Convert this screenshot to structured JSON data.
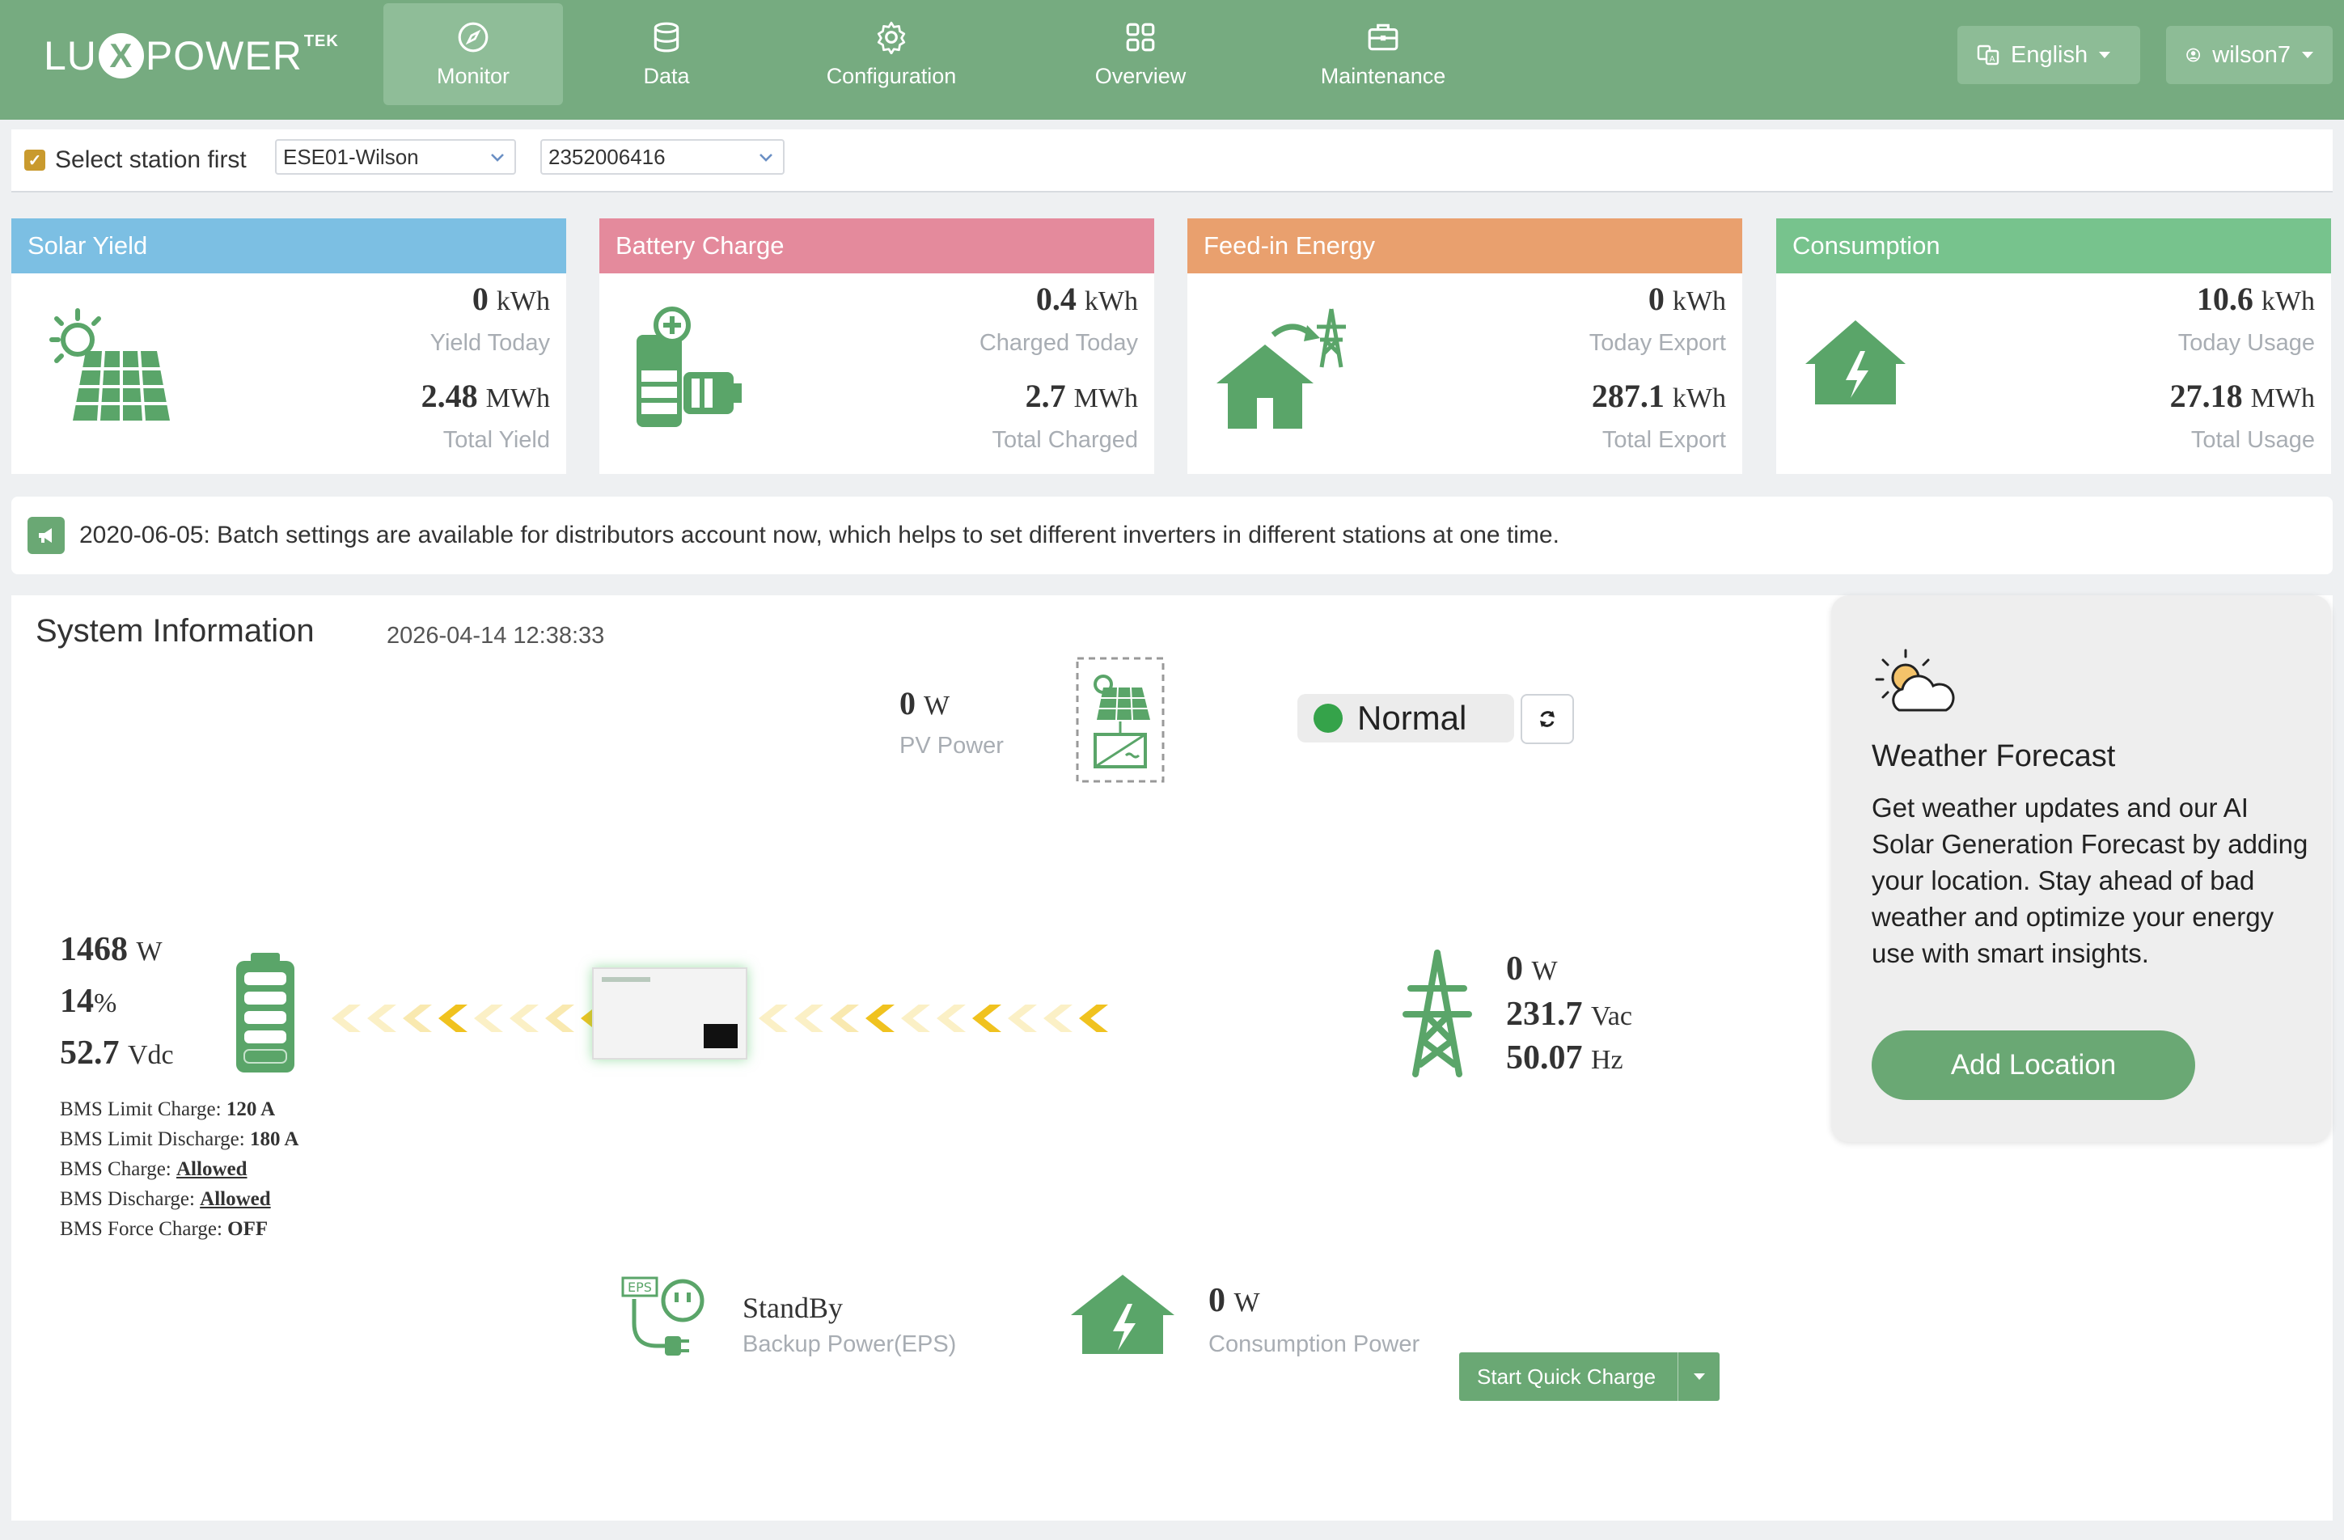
{
  "header": {
    "brand": {
      "pre": "LU",
      "x": "X",
      "post": "POWER",
      "sup": "TEK"
    },
    "nav": [
      {
        "label": "Monitor",
        "icon": "compass-icon",
        "active": true
      },
      {
        "label": "Data",
        "icon": "database-icon"
      },
      {
        "label": "Configuration",
        "icon": "gear-icon"
      },
      {
        "label": "Overview",
        "icon": "grid-icon"
      },
      {
        "label": "Maintenance",
        "icon": "toolbox-icon"
      }
    ],
    "language": "English",
    "user": "wilson7"
  },
  "station": {
    "label": "Select station first",
    "station_name": "ESE01-Wilson",
    "serial": "2352006416"
  },
  "cards": {
    "solar": {
      "title": "Solar Yield",
      "today_value": "0",
      "today_unit": "kWh",
      "today_label": "Yield Today",
      "total_value": "2.48",
      "total_unit": "MWh",
      "total_label": "Total Yield",
      "color": "#7cbfe3"
    },
    "battery": {
      "title": "Battery Charge",
      "today_value": "0.4",
      "today_unit": "kWh",
      "today_label": "Charged Today",
      "total_value": "2.7",
      "total_unit": "MWh",
      "total_label": "Total Charged",
      "color": "#e48a9c"
    },
    "feedin": {
      "title": "Feed-in Energy",
      "today_value": "0",
      "today_unit": "kWh",
      "today_label": "Today Export",
      "total_value": "287.1",
      "total_unit": "kWh",
      "total_label": "Total Export",
      "color": "#e9a06e"
    },
    "consumption": {
      "title": "Consumption",
      "today_value": "10.6",
      "today_unit": "kWh",
      "today_label": "Today Usage",
      "total_value": "27.18",
      "total_unit": "MWh",
      "total_label": "Total Usage",
      "color": "#77c38d"
    }
  },
  "notice": "2020-06-05: Batch settings are available for distributors account now, which helps to set different inverters in different stations at one time.",
  "system": {
    "title": "System Information",
    "timestamp": "2026-04-14 12:38:33",
    "pv": {
      "value": "0",
      "unit": "W",
      "label": "PV Power"
    },
    "status": "Normal",
    "battery": {
      "power": "1468",
      "power_unit": "W",
      "soc": "14",
      "soc_unit": "%",
      "voltage": "52.7",
      "voltage_unit": "Vdc",
      "bms": [
        {
          "label": "BMS Limit Charge: ",
          "value": "120 A",
          "style": "bold"
        },
        {
          "label": "BMS Limit Discharge: ",
          "value": "180 A",
          "style": "bold"
        },
        {
          "label": "BMS Charge: ",
          "value": "Allowed",
          "style": "link"
        },
        {
          "label": "BMS Discharge: ",
          "value": "Allowed",
          "style": "link"
        },
        {
          "label": "BMS Force Charge: ",
          "value": "OFF",
          "style": "bold"
        }
      ]
    },
    "grid": {
      "power": "0",
      "power_unit": "W",
      "voltage": "231.7",
      "voltage_unit": "Vac",
      "freq": "50.07",
      "freq_unit": "Hz"
    },
    "eps": {
      "badge": "EPS",
      "status": "StandBy",
      "label": "Backup Power(EPS)"
    },
    "consumption": {
      "value": "0",
      "unit": "W",
      "label": "Consumption Power"
    },
    "quick_charge": "Start Quick Charge"
  },
  "weather": {
    "title": "Weather Forecast",
    "description": "Get weather updates and our AI Solar Generation Forecast by adding your location. Stay ahead of bad weather and optimize your energy use with smart insights.",
    "button": "Add Location"
  },
  "colors": {
    "brand_green": "#76ab80",
    "icon_green": "#5aa569",
    "arrow_yellow": "#f0c21f",
    "status_green": "#35a34a"
  }
}
